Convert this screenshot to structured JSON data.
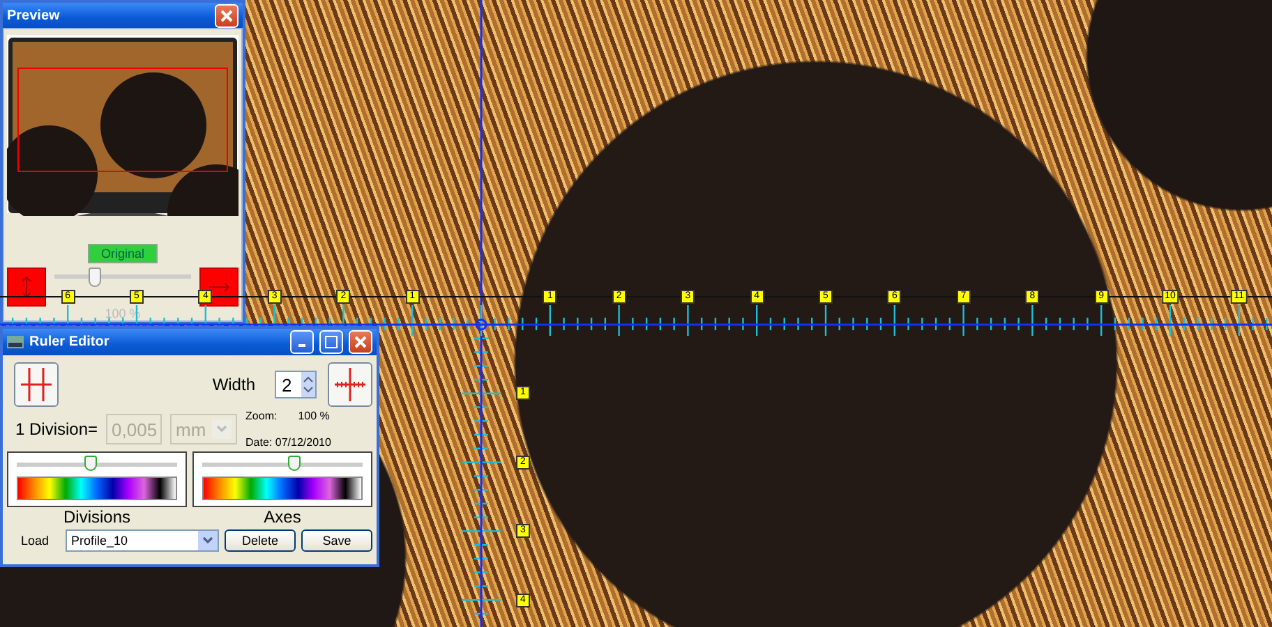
{
  "preview": {
    "title": "Preview",
    "mode_button": "Original",
    "slider": {
      "level": 0.3
    },
    "zoom": "100 %"
  },
  "ruler": {
    "left_labels": [
      "6",
      "5",
      "4",
      "3",
      "2",
      "1"
    ],
    "right_labels": [
      "1",
      "2",
      "3",
      "4",
      "5",
      "6",
      "7",
      "8",
      "9",
      "10",
      "11"
    ],
    "vertical_labels": [
      "1",
      "2",
      "3",
      "4"
    ]
  },
  "ruler_editor": {
    "title": "Ruler Editor",
    "width_label": "Width",
    "width_value": "2",
    "division_label": "1 Division=",
    "division_value": "0,005",
    "division_unit": "mm",
    "division_disabled": true,
    "zoom_label": "Zoom:",
    "zoom_value": "100 %",
    "date": "Date: 07/12/2010",
    "panels": [
      {
        "label": "Divisions",
        "level": 0.46
      },
      {
        "label": "Axes",
        "level": 0.57
      }
    ],
    "load_label": "Load",
    "profile": "Profile_10",
    "buttons": [
      "Delete",
      "Save"
    ]
  }
}
